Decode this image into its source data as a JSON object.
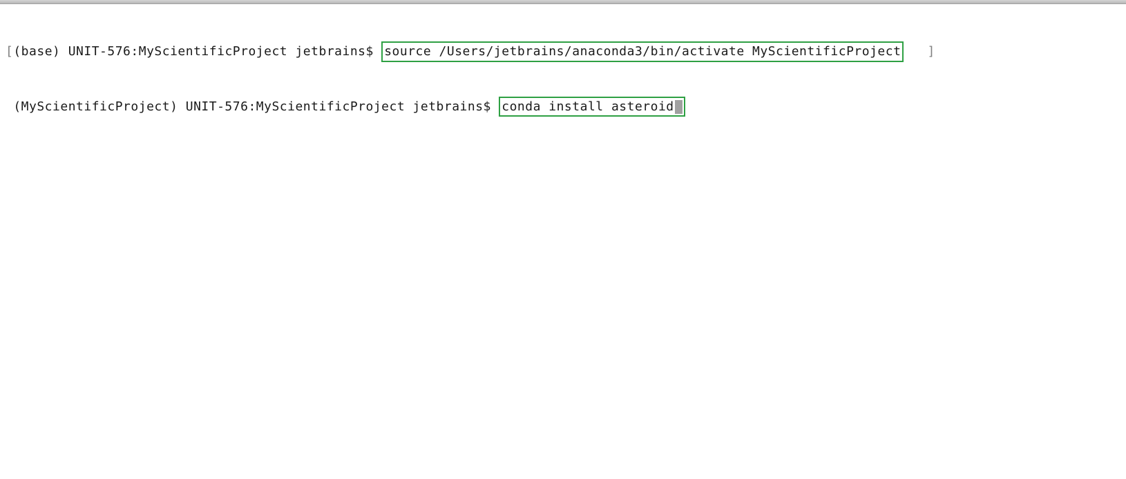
{
  "terminal": {
    "lines": [
      {
        "open_bracket": "[",
        "prompt": "(base) UNIT-576:MyScientificProject jetbrains$ ",
        "command": "source /Users/jetbrains/anaconda3/bin/activate MyScientificProject",
        "trailing": "   ",
        "close_bracket": "]"
      },
      {
        "prompt": " (MyScientificProject) UNIT-576:MyScientificProject jetbrains$ ",
        "command": "conda install asteroid"
      }
    ]
  }
}
